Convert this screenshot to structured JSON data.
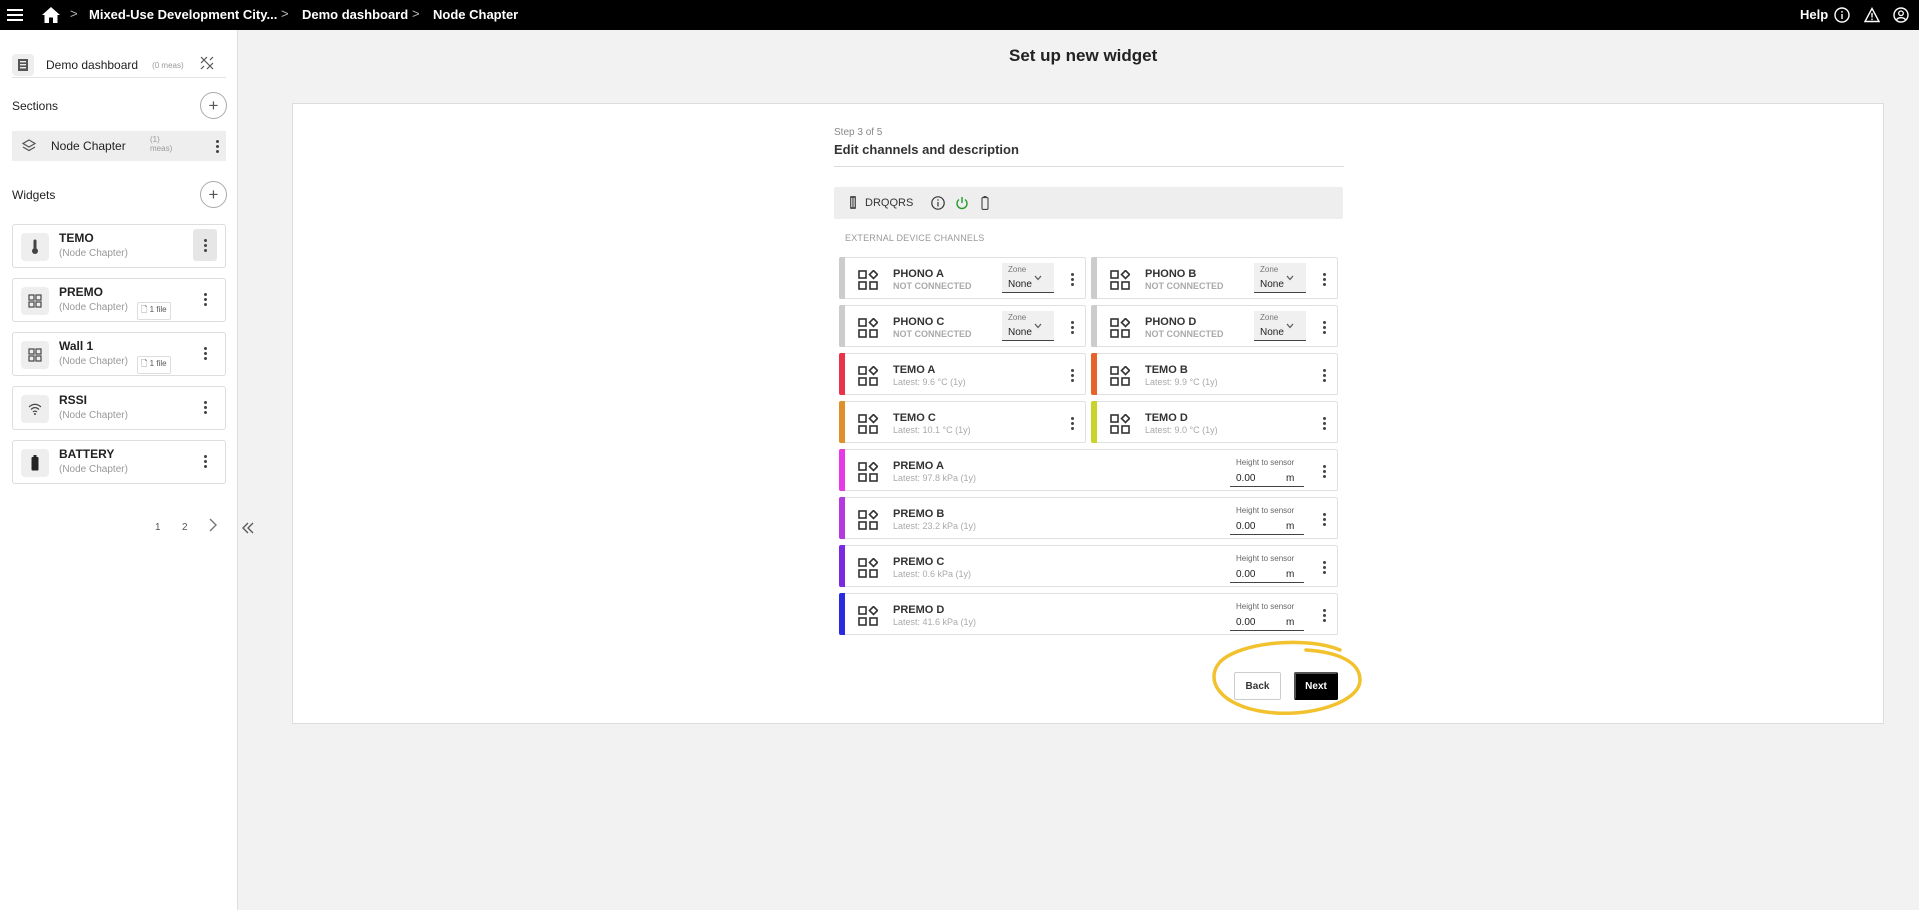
{
  "topbar": {
    "breadcrumbs": [
      "Mixed-Use Development City...",
      "Demo dashboard",
      "Node Chapter"
    ],
    "help_label": "Help"
  },
  "sidebar": {
    "dashboard_name": "Demo dashboard",
    "dashboard_meas": "(0 meas)",
    "sections_label": "Sections",
    "section": {
      "name": "Node Chapter",
      "meas_line1": "(1)",
      "meas_line2": "meas)"
    },
    "widgets_label": "Widgets",
    "widgets": [
      {
        "title": "TEMO",
        "sub": "(Node Chapter)",
        "icon": "thermometer-icon"
      },
      {
        "title": "PREMO",
        "sub": "(Node Chapter)",
        "file": "1 file",
        "icon": "grid-icon"
      },
      {
        "title": "Wall 1",
        "sub": "(Node Chapter)",
        "file": "1 file",
        "icon": "grid-icon"
      },
      {
        "title": "RSSI",
        "sub": "(Node Chapter)",
        "icon": "wifi-icon"
      },
      {
        "title": "BATTERY",
        "sub": "(Node Chapter)",
        "icon": "battery-icon"
      }
    ],
    "pages": [
      "1",
      "2"
    ]
  },
  "main": {
    "page_title": "Set up new widget",
    "step": "Step 3 of 5",
    "step_title": "Edit channels and description",
    "device_name": "DRQQRS",
    "external_label": "EXTERNAL DEVICE CHANNELS",
    "zone_label": "Zone",
    "zone_value": "None",
    "height_label": "Height to sensor",
    "height_value": "0.00",
    "height_unit": "m",
    "channels": [
      {
        "name": "PHONO A",
        "sub": "NOT CONNECTED",
        "color": "#cccccc"
      },
      {
        "name": "PHONO B",
        "sub": "NOT CONNECTED",
        "color": "#cccccc"
      },
      {
        "name": "PHONO C",
        "sub": "NOT CONNECTED",
        "color": "#cccccc"
      },
      {
        "name": "PHONO D",
        "sub": "NOT CONNECTED",
        "color": "#cccccc"
      },
      {
        "name": "TEMO A",
        "sub": "Latest: 9.6 °C (1y)",
        "color": "#e8334a"
      },
      {
        "name": "TEMO B",
        "sub": "Latest: 9.9 °C (1y)",
        "color": "#e8632a"
      },
      {
        "name": "TEMO C",
        "sub": "Latest: 10.1 °C (1y)",
        "color": "#e0902a"
      },
      {
        "name": "TEMO D",
        "sub": "Latest: 9.0 °C (1y)",
        "color": "#c8d42a"
      },
      {
        "name": "PREMO A",
        "sub": "Latest: 97.8 kPa (1y)",
        "color": "#e63ae6"
      },
      {
        "name": "PREMO B",
        "sub": "Latest: 23.2 kPa (1y)",
        "color": "#b43ae0"
      },
      {
        "name": "PREMO C",
        "sub": "Latest: 0.6 kPa (1y)",
        "color": "#7a2ae0"
      },
      {
        "name": "PREMO D",
        "sub": "Latest: 41.6 kPa (1y)",
        "color": "#2a2ae0"
      }
    ],
    "back_label": "Back",
    "next_label": "Next",
    "highlight_color": "#f2c12e"
  }
}
